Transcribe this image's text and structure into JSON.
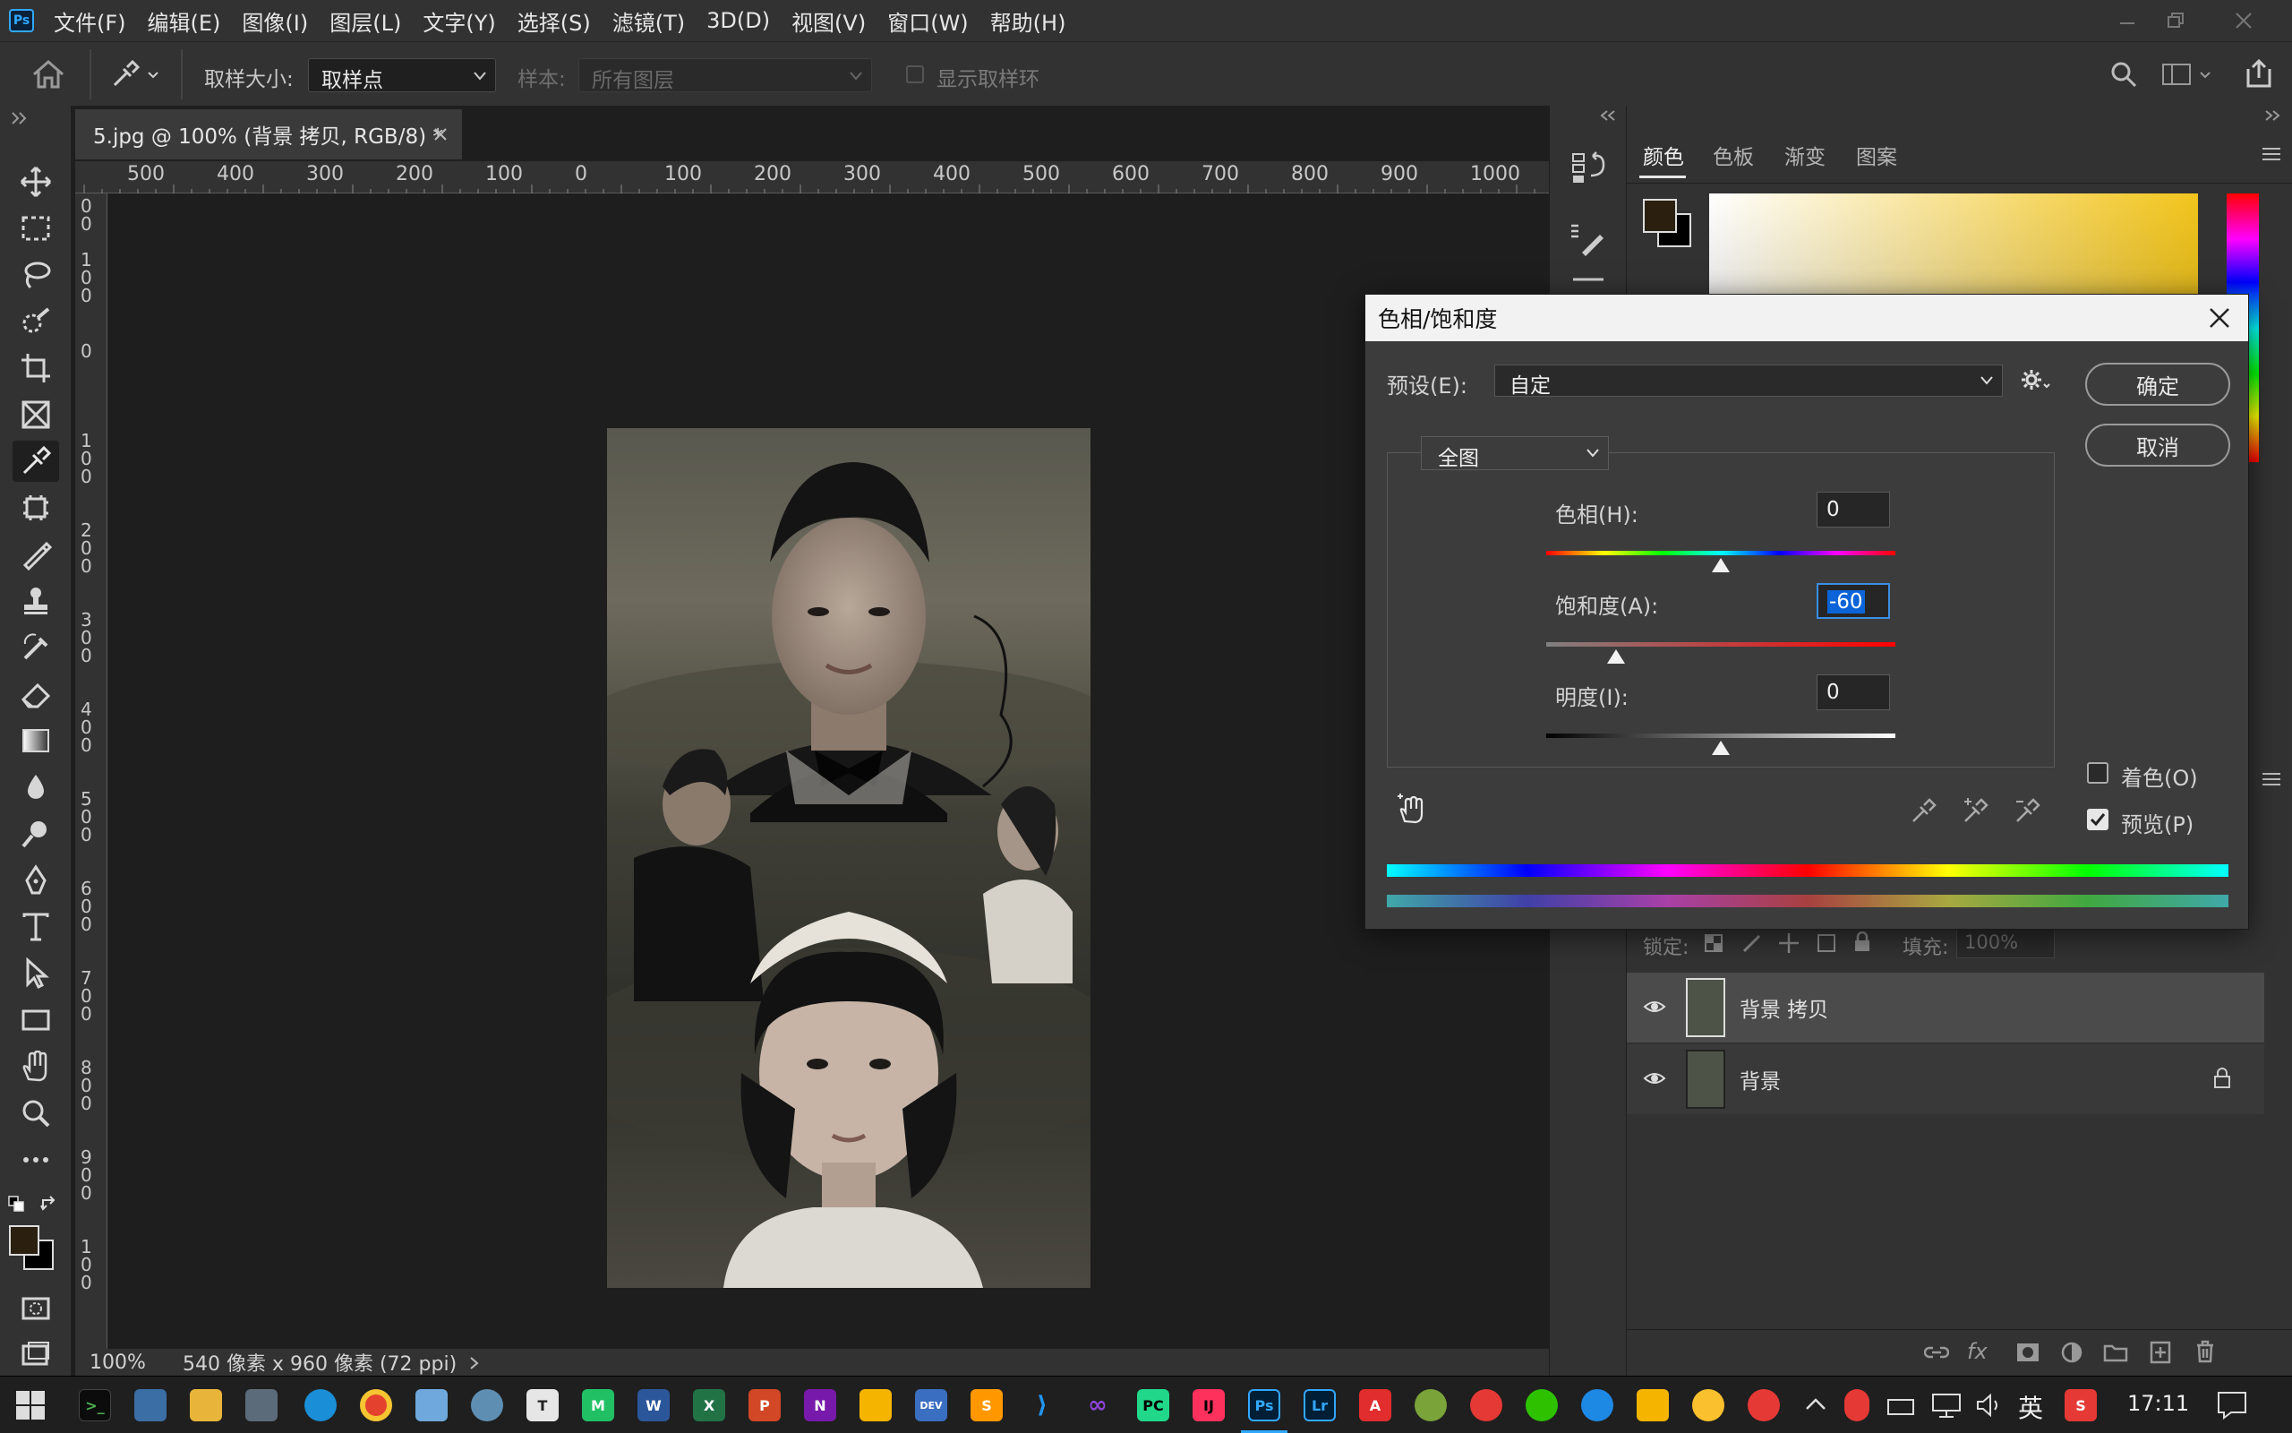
{
  "app": {
    "logo_text": "Ps",
    "menus": [
      "文件(F)",
      "编辑(E)",
      "图像(I)",
      "图层(L)",
      "文字(Y)",
      "选择(S)",
      "滤镜(T)",
      "3D(D)",
      "视图(V)",
      "窗口(W)",
      "帮助(H)"
    ]
  },
  "options": {
    "sample_size_label": "取样大小:",
    "sample_size_value": "取样点",
    "sample_label": "样本:",
    "sample_value": "所有图层",
    "show_ring_label": "显示取样环"
  },
  "document": {
    "tab_title": "5.jpg @ 100% (背景 拷贝, RGB/8) *",
    "ruler_top": [
      "500",
      "400",
      "300",
      "200",
      "100",
      "0",
      "100",
      "200",
      "300",
      "400",
      "500",
      "600",
      "700",
      "800",
      "900",
      "1000"
    ],
    "ruler_left": [
      "0\n0",
      "1\n0\n0",
      "0",
      "1\n0\n0",
      "2\n0\n0",
      "3\n0\n0",
      "4\n0\n0",
      "5\n0\n0",
      "6\n0\n0",
      "7\n0\n0",
      "8\n0\n0",
      "9\n0\n0",
      "1\n0\n0"
    ],
    "zoom": "100%",
    "size_info": "540 像素 x 960 像素 (72 ppi)"
  },
  "panels": {
    "tabs": [
      "颜色",
      "色板",
      "渐变",
      "图案"
    ],
    "lock_label": "锁定:",
    "fill_label": "填充:",
    "fill_value": "100%",
    "layers": [
      {
        "name": "背景 拷贝",
        "selected": true,
        "locked": false
      },
      {
        "name": "背景",
        "selected": false,
        "locked": true
      }
    ]
  },
  "dialog": {
    "title": "色相/饱和度",
    "preset_label": "预设(E):",
    "preset_value": "自定",
    "channel_value": "全图",
    "hue_label": "色相(H):",
    "hue_value": "0",
    "saturation_label": "饱和度(A):",
    "saturation_value": "-60",
    "lightness_label": "明度(I):",
    "lightness_value": "0",
    "ok_label": "确定",
    "cancel_label": "取消",
    "colorize_label": "着色(O)",
    "preview_label": "预览(P)",
    "colorize_checked": false,
    "preview_checked": true
  },
  "taskbar": {
    "ime": "英",
    "time": "17:11"
  },
  "colors": {
    "accent": "#31a8ff",
    "foreground_swatch": "#2b2010",
    "selection_highlight": "#0a64d8"
  }
}
